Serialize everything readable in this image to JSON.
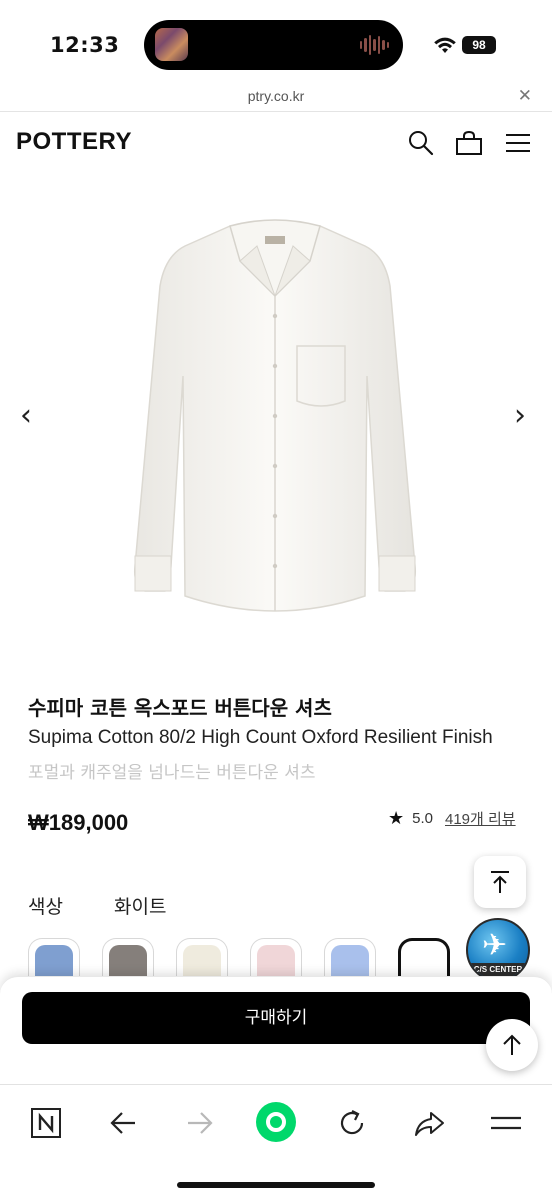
{
  "status": {
    "time": "12:33",
    "battery": "98",
    "icons": [
      "now-playing-art",
      "audio-wave-icon",
      "wifi-icon",
      "battery-icon"
    ]
  },
  "browser": {
    "url": "ptry.co.kr",
    "close_icon": "close-icon"
  },
  "site": {
    "logo": "POTTERY",
    "header_icons": [
      "search-icon",
      "shopping-bag-icon",
      "hamburger-menu-icon"
    ]
  },
  "gallery": {
    "prev": "‹",
    "next": "›"
  },
  "product": {
    "title": "수피마 코튼 옥스포드 버튼다운 셔츠",
    "subtitle": "Supima Cotton 80/2 High Count Oxford Resilient Finish",
    "description": "포멀과 캐주얼을 넘나드는 버튼다운 셔츠",
    "price": "₩189,000",
    "rating": "5.0",
    "reviews": "419개 리뷰"
  },
  "options": {
    "color_label": "색상",
    "color_value": "화이트",
    "swatches": [
      {
        "color": "#7f9fd0"
      },
      {
        "color": "#857f7b"
      },
      {
        "color": "#efebde"
      },
      {
        "color": "#f0d6d8"
      },
      {
        "color": "#a9c0ec"
      },
      {
        "color": "#ffffff",
        "selected": true
      }
    ]
  },
  "cs_badge": {
    "label": "C/S CENTER"
  },
  "purchase": {
    "buy_label": "구매하기"
  },
  "toolbar": {
    "icons": [
      "naver-n-icon",
      "back-arrow-icon",
      "forward-arrow-icon",
      "green-home-icon",
      "reload-icon",
      "share-icon",
      "menu-icon"
    ]
  },
  "colors": {
    "accent_green": "#00d86b",
    "button_black": "#000000"
  }
}
